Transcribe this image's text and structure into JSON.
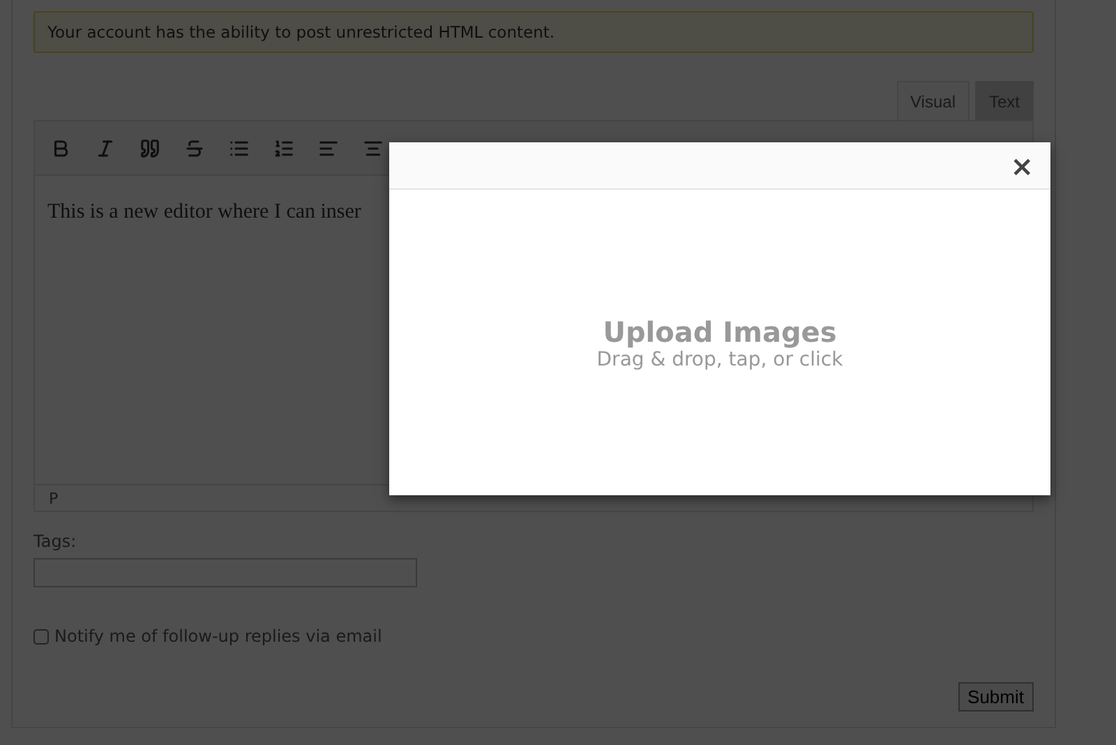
{
  "notice": {
    "text": "Your account has the ability to post unrestricted HTML content."
  },
  "editor": {
    "tabs": [
      {
        "label": "Visual",
        "selected": true
      },
      {
        "label": "Text",
        "selected": false
      }
    ],
    "toolbar": [
      {
        "kind": "bold"
      },
      {
        "kind": "italic"
      },
      {
        "kind": "quote"
      },
      {
        "kind": "strike"
      },
      {
        "kind": "bullets"
      },
      {
        "kind": "numbers"
      },
      {
        "kind": "align-left"
      },
      {
        "kind": "align-center"
      }
    ],
    "content": "This is a new editor where I can inser",
    "path": "P"
  },
  "tags": {
    "label": "Tags:"
  },
  "notify": {
    "label": "Notify me of follow-up replies via email",
    "checked": false
  },
  "submit": {
    "label": "Submit"
  },
  "modal": {
    "close": "×",
    "title": "Upload Images",
    "subtitle": "Drag & drop, tap, or click"
  }
}
